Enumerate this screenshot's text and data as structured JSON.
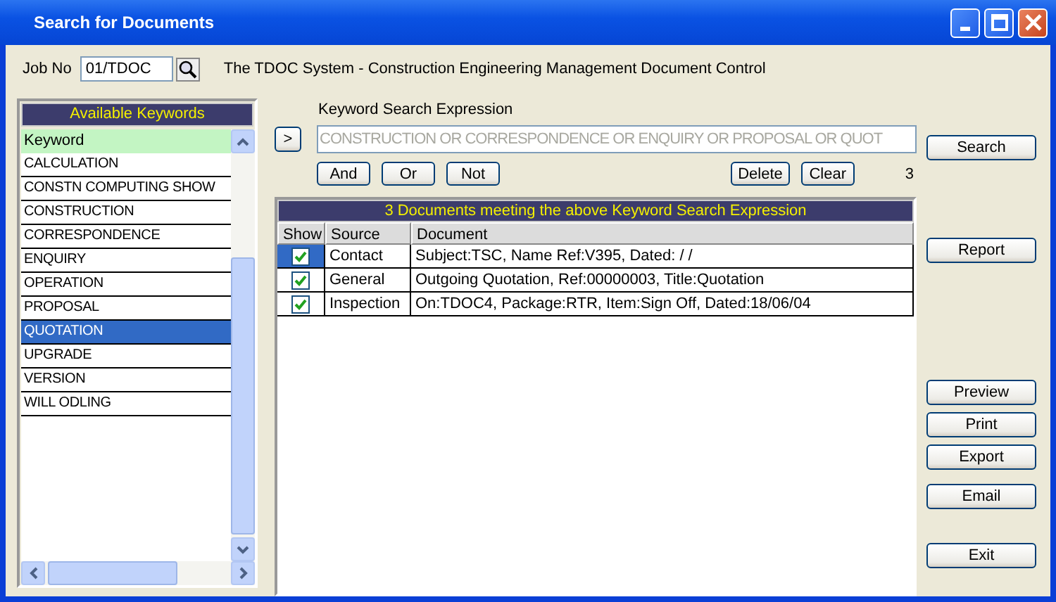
{
  "window": {
    "title": "Search for Documents"
  },
  "job_no": {
    "label": "Job No",
    "value": "01/TDOC"
  },
  "system_title": "The TDOC System - Construction Engineering Management Document Control",
  "keywords": {
    "title": "Available Keywords",
    "header": "Keyword",
    "items": [
      {
        "label": "CALCULATION",
        "selected": false
      },
      {
        "label": "CONSTN COMPUTING SHOW",
        "selected": false
      },
      {
        "label": "CONSTRUCTION",
        "selected": false
      },
      {
        "label": "CORRESPONDENCE",
        "selected": false
      },
      {
        "label": "ENQUIRY",
        "selected": false
      },
      {
        "label": "OPERATION",
        "selected": false
      },
      {
        "label": "PROPOSAL",
        "selected": false
      },
      {
        "label": "QUOTATION",
        "selected": true
      },
      {
        "label": "UPGRADE",
        "selected": false
      },
      {
        "label": "VERSION",
        "selected": false
      },
      {
        "label": "WILL ODLING",
        "selected": false
      }
    ]
  },
  "expression": {
    "label": "Keyword Search Expression",
    "add_button": ">",
    "value": "CONSTRUCTION OR CORRESPONDENCE OR ENQUIRY OR PROPOSAL OR QUOT",
    "disabled": true,
    "operators": [
      "And",
      "Or",
      "Not"
    ],
    "edit_buttons": [
      "Delete",
      "Clear"
    ],
    "count": "3"
  },
  "search_button": "Search",
  "results": {
    "title": "3 Documents meeting the above Keyword Search Expression",
    "columns": [
      "Show",
      "Source",
      "Document"
    ],
    "rows": [
      {
        "show": true,
        "selected": true,
        "source": "Contact",
        "document": "Subject:TSC, Name Ref:V395, Dated:  /  /"
      },
      {
        "show": true,
        "selected": false,
        "source": "General",
        "document": "Outgoing Quotation, Ref:00000003, Title:Quotation"
      },
      {
        "show": true,
        "selected": false,
        "source": "Inspection",
        "document": "On:TDOC4, Package:RTR, Item:Sign Off, Dated:18/06/04"
      }
    ]
  },
  "report_button": "Report",
  "output_buttons": [
    "Preview",
    "Print",
    "Export",
    "Email"
  ],
  "exit_button": "Exit"
}
